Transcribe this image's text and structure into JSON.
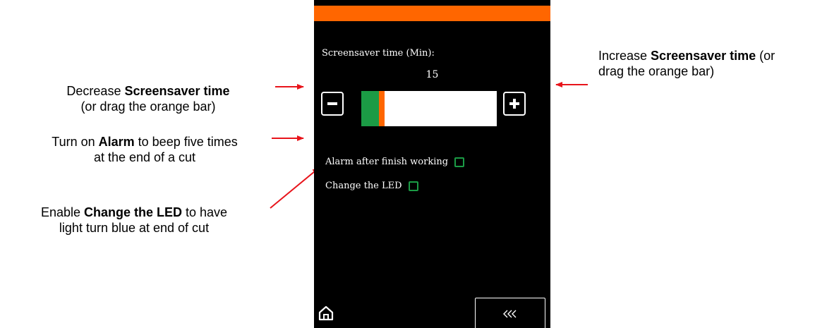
{
  "device": {
    "screensaver_label": "Screensaver time (Min):",
    "screensaver_value": "15",
    "slider_fill_fraction": 0.13,
    "options": [
      {
        "label": "Alarm after finish working",
        "checked": false
      },
      {
        "label": "Change the LED",
        "checked": false
      }
    ],
    "back_label": "«‹",
    "icons": {
      "decrease": "minus-icon",
      "increase": "plus-icon",
      "home": "home-icon",
      "back": "triple-chevron-left-icon"
    },
    "colors": {
      "header": "#ff6600",
      "slider_fill": "#1b9b45",
      "handle": "#ff6600",
      "screen": "#000000"
    }
  },
  "annotations": {
    "decrease": {
      "prefix": "Decrease ",
      "bold": "Screensaver time",
      "line2": "(or drag the orange bar)"
    },
    "increase": {
      "prefix": "Increase ",
      "bold": "Screensaver time",
      "suffix": " (or",
      "line2": "drag the orange bar)"
    },
    "alarm": {
      "prefix": "Turn on ",
      "bold": "Alarm",
      "suffix": " to beep five times",
      "line2": "at the end of a cut"
    },
    "led": {
      "prefix": "Enable ",
      "bold": "Change the LED",
      "suffix": " to have",
      "line2": "light turn blue at end of cut"
    }
  }
}
